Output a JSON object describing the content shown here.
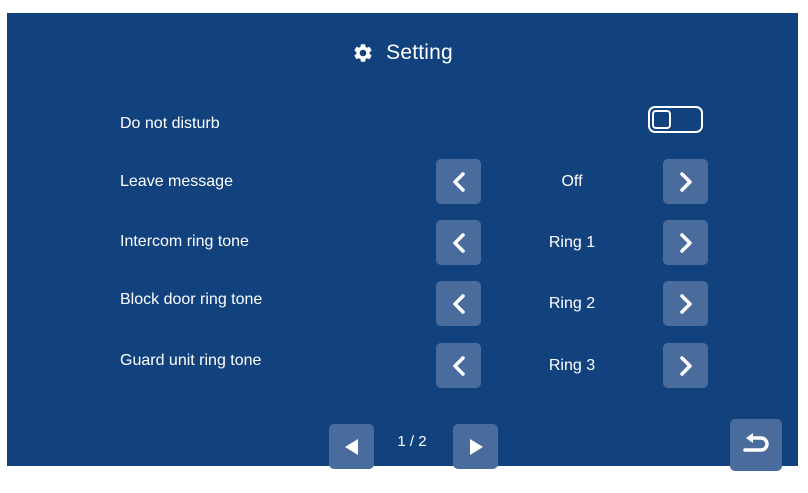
{
  "colors": {
    "background": "#12427e",
    "button": "#4a6c9d",
    "text": "#ffffff"
  },
  "header": {
    "icon": "gear-icon",
    "title": "Setting"
  },
  "do_not_disturb": {
    "label": "Do not disturb",
    "enabled": false
  },
  "settings": [
    {
      "label": "Leave message",
      "value": "Off"
    },
    {
      "label": "Intercom ring tone",
      "value": "Ring 1"
    },
    {
      "label": "Block door ring tone",
      "value": "Ring 2"
    },
    {
      "label": "Guard unit ring tone",
      "value": "Ring 3"
    }
  ],
  "pager": {
    "indicator": "1 / 2",
    "prev_icon": "triangle-left-icon",
    "next_icon": "triangle-right-icon"
  },
  "back": {
    "icon": "return-arrow-icon"
  }
}
